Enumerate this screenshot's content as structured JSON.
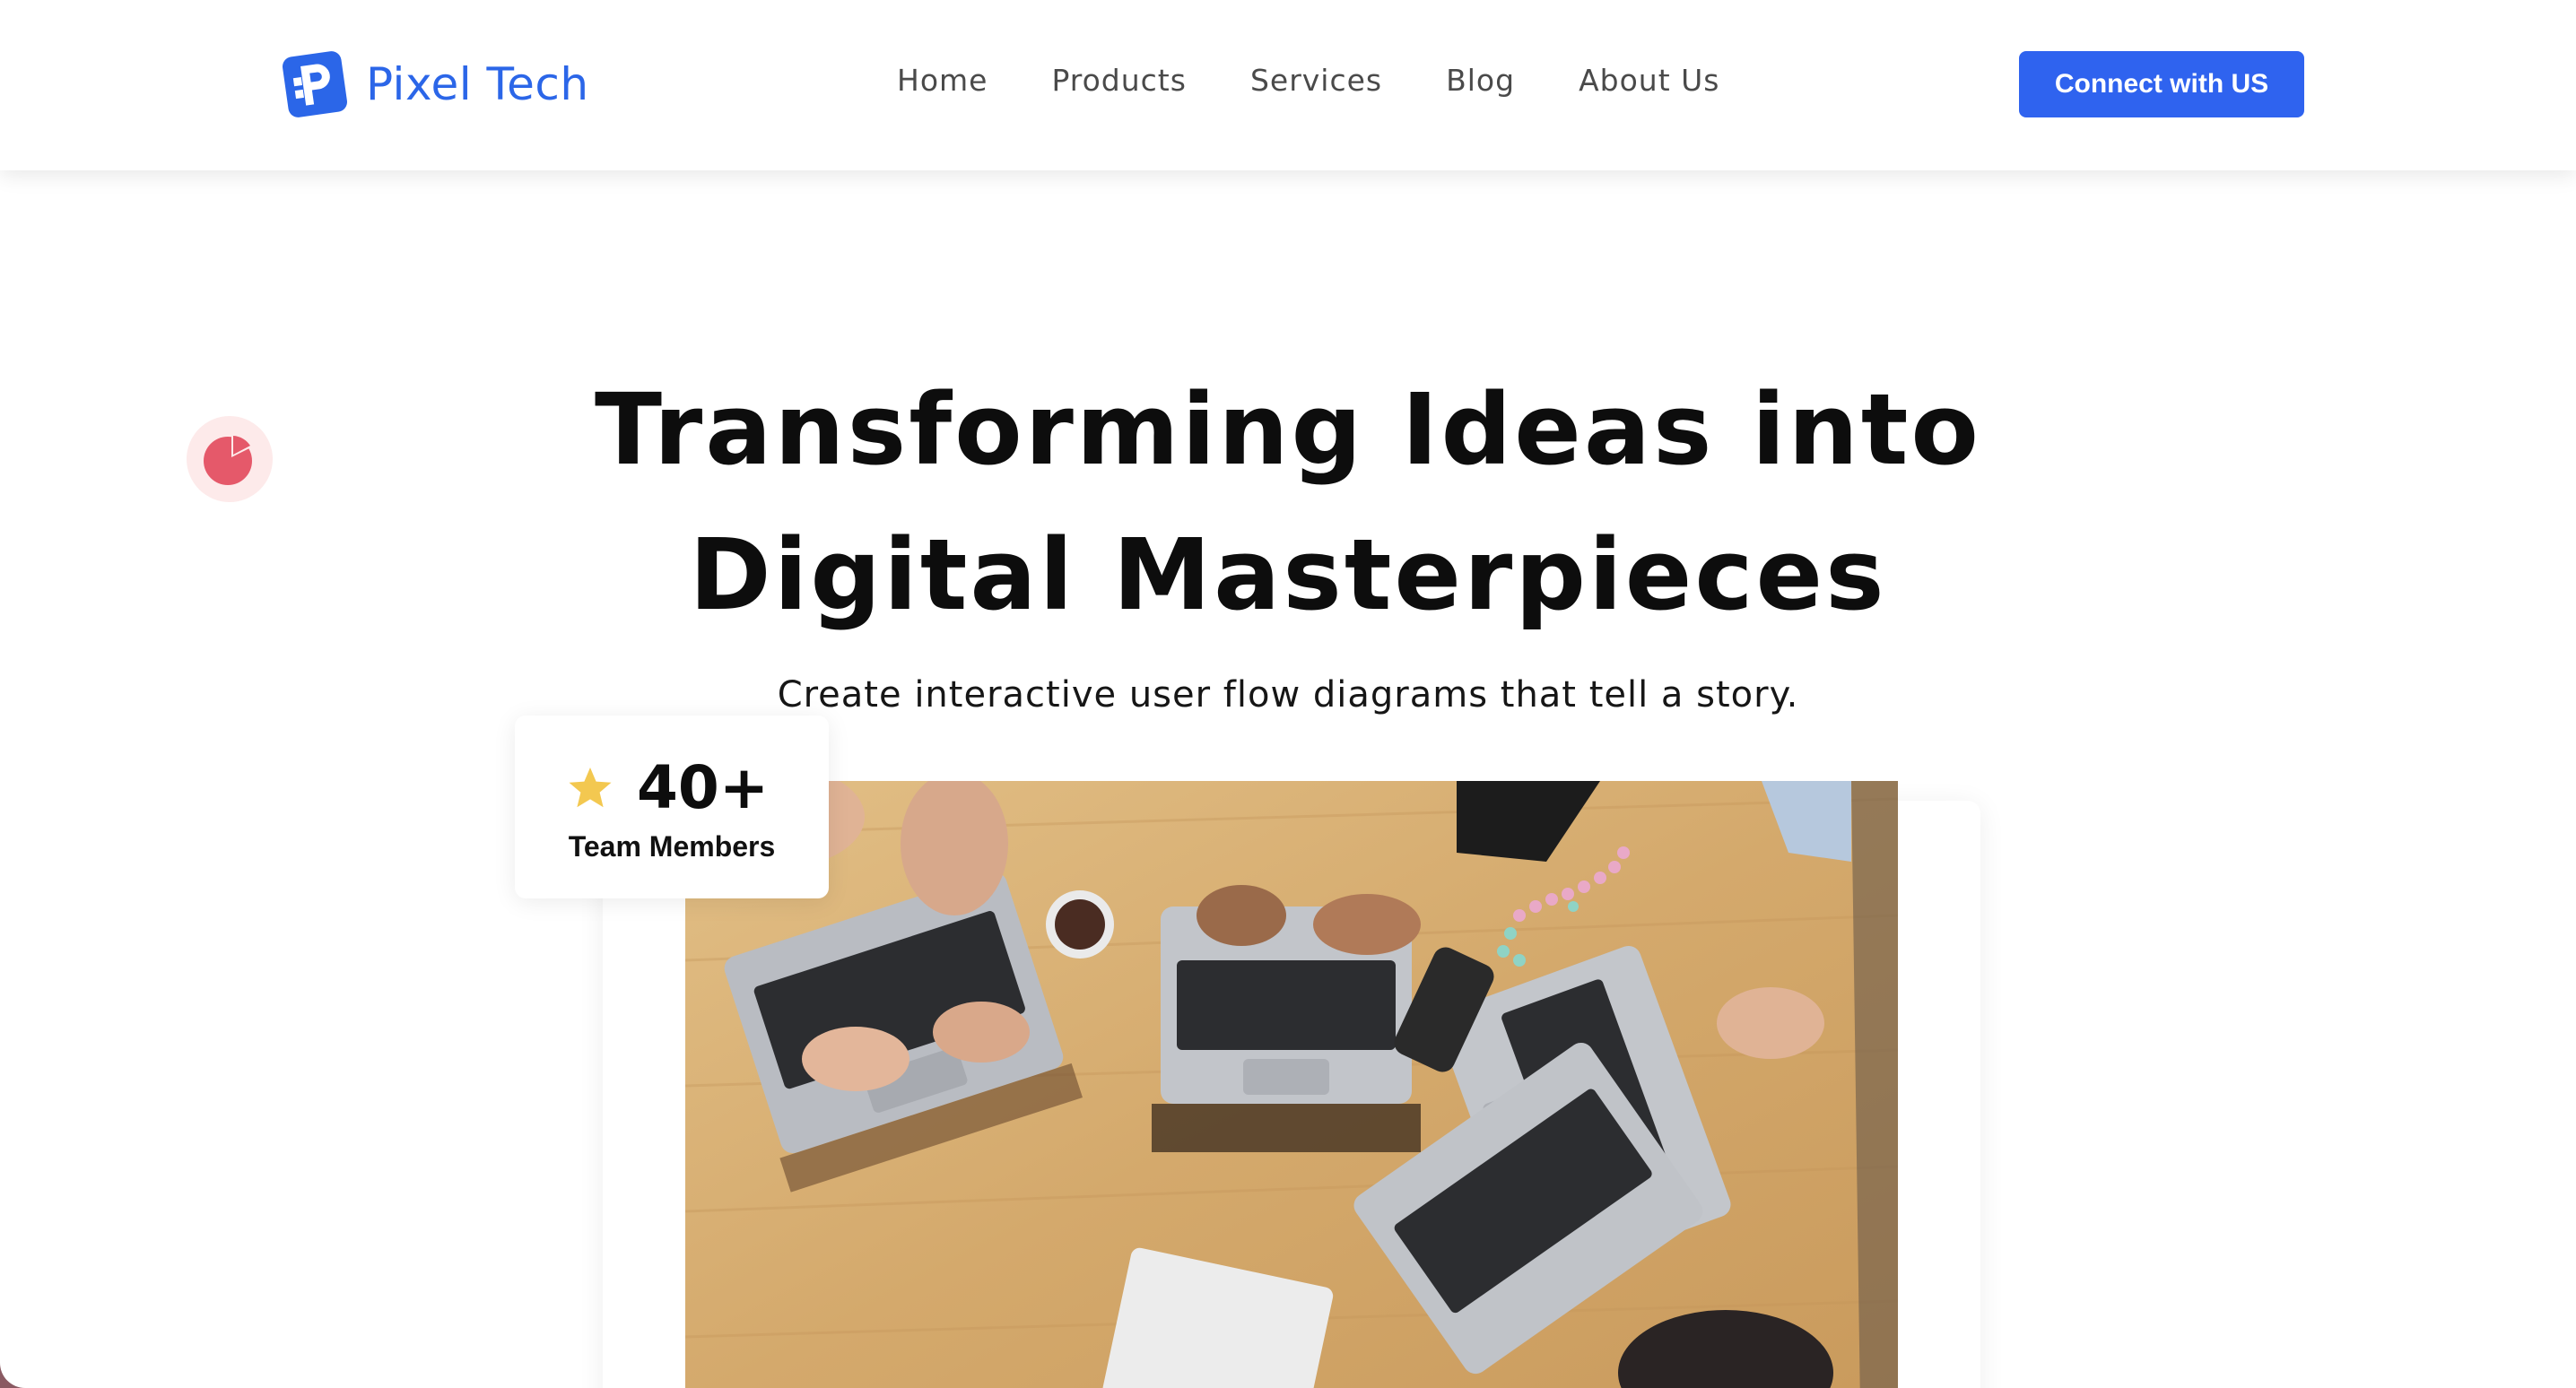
{
  "brand": {
    "name": "Pixel Tech",
    "accent": "#2f63ef"
  },
  "nav": {
    "items": [
      {
        "label": "Home"
      },
      {
        "label": "Products"
      },
      {
        "label": "Services"
      },
      {
        "label": "Blog"
      },
      {
        "label": "About Us"
      }
    ],
    "cta_label": "Connect with US"
  },
  "hero": {
    "title": "Transforming Ideas into Digital Masterpieces",
    "subtitle": "Create interactive user flow diagrams that tell a story."
  },
  "stat": {
    "icon": "star-icon",
    "value": "40+",
    "label": "Team Members"
  },
  "decor": {
    "pie_icon_color": "#e5596a",
    "pie_bg_color": "#fdeaea"
  }
}
